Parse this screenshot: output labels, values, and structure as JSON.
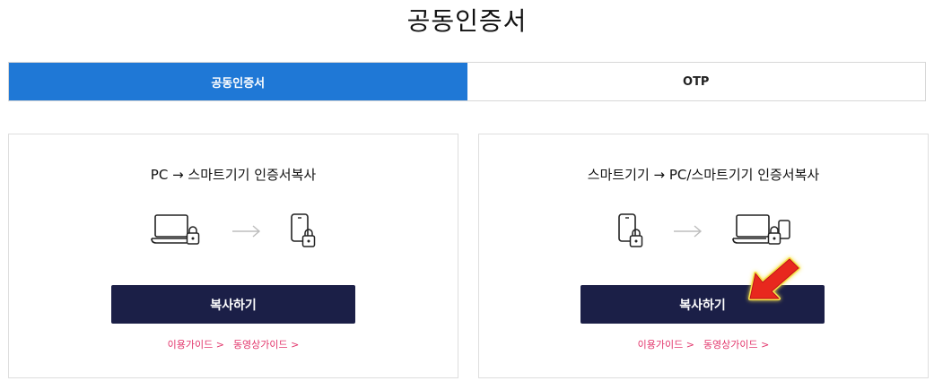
{
  "page": {
    "title": "공동인증서"
  },
  "tabs": [
    {
      "label": "공동인증서",
      "active": true
    },
    {
      "label": "OTP",
      "active": false
    }
  ],
  "cards": [
    {
      "title": "PC → 스마트기기 인증서복사",
      "button_label": "복사하기",
      "links": {
        "guide": "이용가이드  >",
        "video_guide": "동영상가이드  >"
      },
      "icons": [
        "laptop-lock-icon",
        "arrow-right-icon",
        "phone-lock-icon"
      ]
    },
    {
      "title": "스마트기기 → PC/스마트기기 인증서복사",
      "button_label": "복사하기",
      "links": {
        "guide": "이용가이드  >",
        "video_guide": "동영상가이드  >"
      },
      "icons": [
        "phone-lock-icon",
        "arrow-right-icon",
        "laptop-phone-lock-icon"
      ]
    }
  ],
  "colors": {
    "tab_active": "#1f78d6",
    "button": "#1b1f47",
    "link": "#e2356b",
    "annotation_arrow": "#e8281e"
  }
}
